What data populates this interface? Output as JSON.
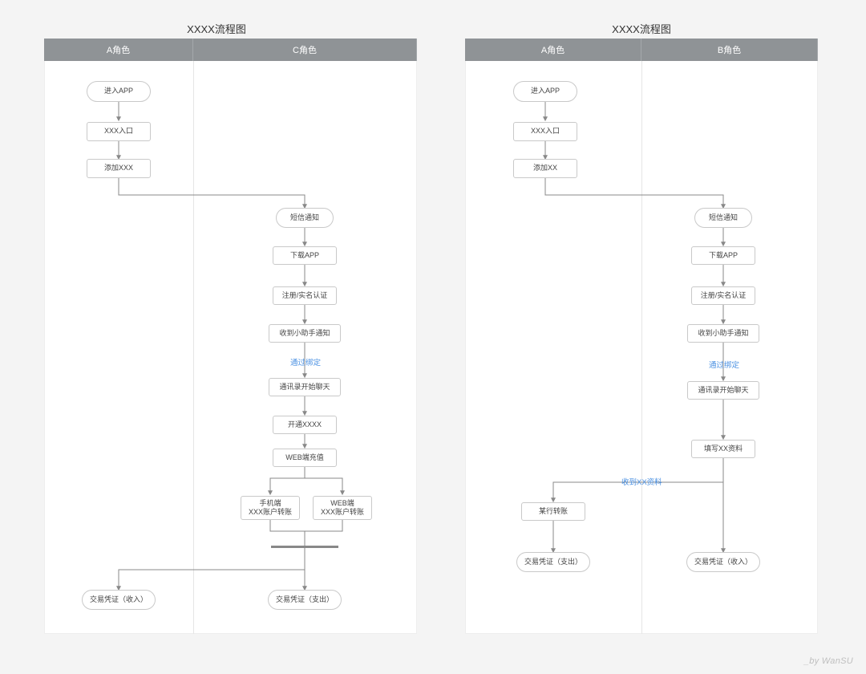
{
  "watermark": "_by WanSU",
  "colors": {
    "edge": "#888888",
    "label": "#4a90e2"
  },
  "left": {
    "title": "XXXX流程图",
    "columns": [
      "A角色",
      "C角色"
    ],
    "nodes": {
      "enter": "进入APP",
      "entry": "XXX入口",
      "add": "添加XXX",
      "sms": "短信通知",
      "download": "下载APP",
      "register": "注册/实名认证",
      "assistant": "收到小助手通知",
      "contacts": "通讯录开始聊天",
      "open": "开通XXXX",
      "topup": "WEB端充值",
      "phone": {
        "l1": "手机端",
        "l2": "XXX账户转账"
      },
      "web": {
        "l1": "WEB端",
        "l2": "XXX账户转账"
      },
      "receipt_in": "交易凭证（收入）",
      "receipt_out": "交易凭证（支出）"
    },
    "edge_labels": {
      "bind": "通过绑定"
    }
  },
  "right": {
    "title": "XXXX流程图",
    "columns": [
      "A角色",
      "B角色"
    ],
    "nodes": {
      "enter": "进入APP",
      "entry": "XXX入口",
      "add": "添加XX",
      "sms": "短信通知",
      "download": "下载APP",
      "register": "注册/实名认证",
      "assistant": "收到小助手通知",
      "contacts": "通讯录开始聊天",
      "fill": "填写XX资料",
      "transfer": "某行转账",
      "receipt_out": "交易凭证（支出）",
      "receipt_in": "交易凭证（收入）"
    },
    "edge_labels": {
      "bind": "通过绑定",
      "recv": "收到XX资料"
    }
  }
}
